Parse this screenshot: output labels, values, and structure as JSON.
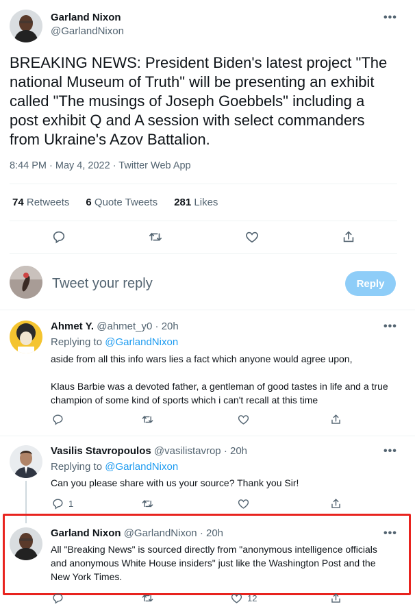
{
  "main_tweet": {
    "author_name": "Garland Nixon",
    "author_handle": "@GarlandNixon",
    "text": "BREAKING NEWS: President Biden's latest project \"The national Museum of Truth\" will be presenting an exhibit called \"The musings of Joseph Goebbels\" including a post exhibit Q and A session with select commanders from Ukraine's Azov Battalion.",
    "timestamp": "8:44 PM · May 4, 2022 · Twitter Web App",
    "stats": {
      "retweets_count": "74",
      "retweets_label": "Retweets",
      "quote_count": "6",
      "quote_label": "Quote Tweets",
      "likes_count": "281",
      "likes_label": "Likes"
    }
  },
  "composer": {
    "placeholder": "Tweet your reply",
    "button_label": "Reply"
  },
  "replies": [
    {
      "name": "Ahmet Y.",
      "handle": "@ahmet_y0",
      "time": "20h",
      "replying_prefix": "Replying to",
      "replying_to": "@GarlandNixon",
      "paragraph1": "aside from all this info wars lies a fact which anyone would agree upon,",
      "paragraph2": "Klaus Barbie was a devoted father, a gentleman of good tastes in life and a true champion of some kind of sports which i can't recall at this time"
    },
    {
      "name": "Vasilis Stavropoulos",
      "handle": "@vasilistavrop",
      "time": "20h",
      "replying_prefix": "Replying to",
      "replying_to": "@GarlandNixon",
      "text": "Can you please share with us your source? Thank you Sir!",
      "reply_count": "1"
    },
    {
      "name": "Garland Nixon",
      "handle": "@GarlandNixon",
      "time": "20h",
      "text": "All \"Breaking News\" is sourced directly from \"anonymous intelligence officials and anonymous White House insiders\" just like the Washington Post and the New York Times.",
      "like_count": "12"
    }
  ],
  "separator": "·",
  "more_glyph": "•••",
  "colors": {
    "accent": "#1d9bf0",
    "reply_button_disabled": "#8ecdf8",
    "highlight_border": "#e8231e",
    "muted_text": "#536471"
  }
}
